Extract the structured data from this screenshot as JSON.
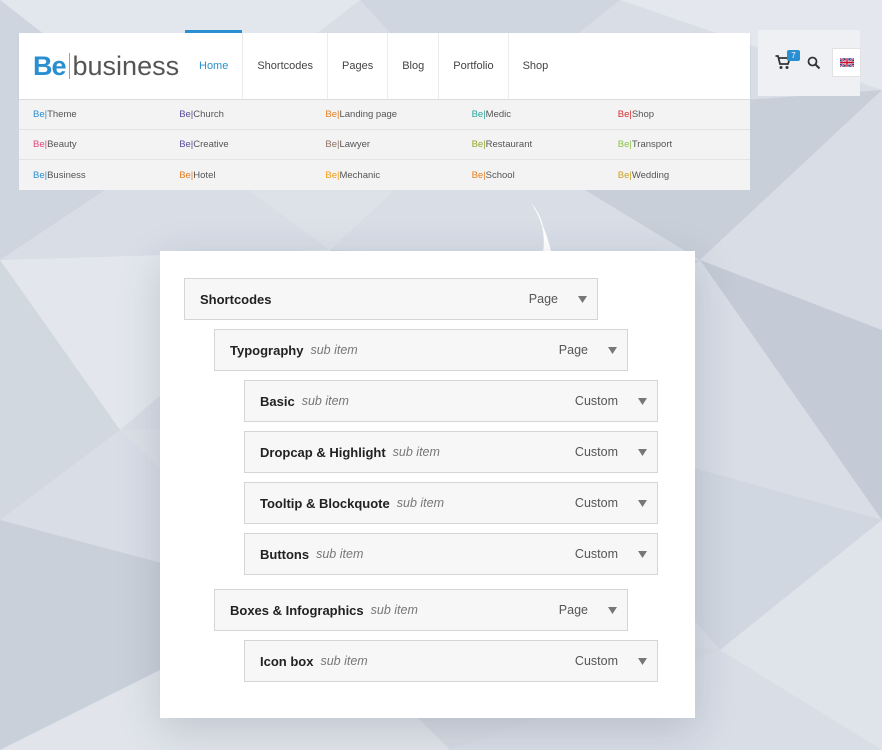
{
  "header": {
    "logo": {
      "brand": "Be",
      "name": "business"
    },
    "menu": [
      {
        "label": "Home",
        "active": true
      },
      {
        "label": "Shortcodes",
        "active": false
      },
      {
        "label": "Pages",
        "active": false
      },
      {
        "label": "Blog",
        "active": false
      },
      {
        "label": "Portfolio",
        "active": false
      },
      {
        "label": "Shop",
        "active": false
      }
    ],
    "cart_count": "7",
    "colors": {
      "accent": "#2a8fd0"
    }
  },
  "mega_menu": {
    "rows": [
      [
        {
          "prefix": "Be|",
          "name": "Theme",
          "color": "#2a8fd0"
        },
        {
          "prefix": "Be|",
          "name": "Church",
          "color": "#5b4a9e"
        },
        {
          "prefix": "Be|",
          "name": "Landing page",
          "color": "#e67e22"
        },
        {
          "prefix": "Be|",
          "name": "Medic",
          "color": "#26a69a"
        },
        {
          "prefix": "Be|",
          "name": "Shop",
          "color": "#d32f2f"
        }
      ],
      [
        {
          "prefix": "Be|",
          "name": "Beauty",
          "color": "#e0457b"
        },
        {
          "prefix": "Be|",
          "name": "Creative",
          "color": "#5b4a9e"
        },
        {
          "prefix": "Be|",
          "name": "Lawyer",
          "color": "#8d6e63"
        },
        {
          "prefix": "Be|",
          "name": "Restaurant",
          "color": "#9aa52b"
        },
        {
          "prefix": "Be|",
          "name": "Transport",
          "color": "#8bc34a"
        }
      ],
      [
        {
          "prefix": "Be|",
          "name": "Business",
          "color": "#2a8fd0"
        },
        {
          "prefix": "Be|",
          "name": "Hotel",
          "color": "#e67e22"
        },
        {
          "prefix": "Be|",
          "name": "Mechanic",
          "color": "#f39c12"
        },
        {
          "prefix": "Be|",
          "name": "School",
          "color": "#e67e22"
        },
        {
          "prefix": "Be|",
          "name": "Wedding",
          "color": "#c9a227"
        }
      ]
    ]
  },
  "menu_structure": {
    "items": [
      {
        "title": "Shortcodes",
        "sub": "",
        "type": "Page"
      },
      {
        "title": "Typography",
        "sub": "sub item",
        "type": "Page"
      },
      {
        "title": "Basic",
        "sub": "sub item",
        "type": "Custom"
      },
      {
        "title": "Dropcap & Highlight",
        "sub": "sub item",
        "type": "Custom"
      },
      {
        "title": "Tooltip & Blockquote",
        "sub": "sub item",
        "type": "Custom"
      },
      {
        "title": "Buttons",
        "sub": "sub item",
        "type": "Custom"
      },
      {
        "title": "Boxes & Infographics",
        "sub": "sub item",
        "type": "Page"
      },
      {
        "title": "Icon box",
        "sub": "sub item",
        "type": "Custom"
      }
    ]
  }
}
